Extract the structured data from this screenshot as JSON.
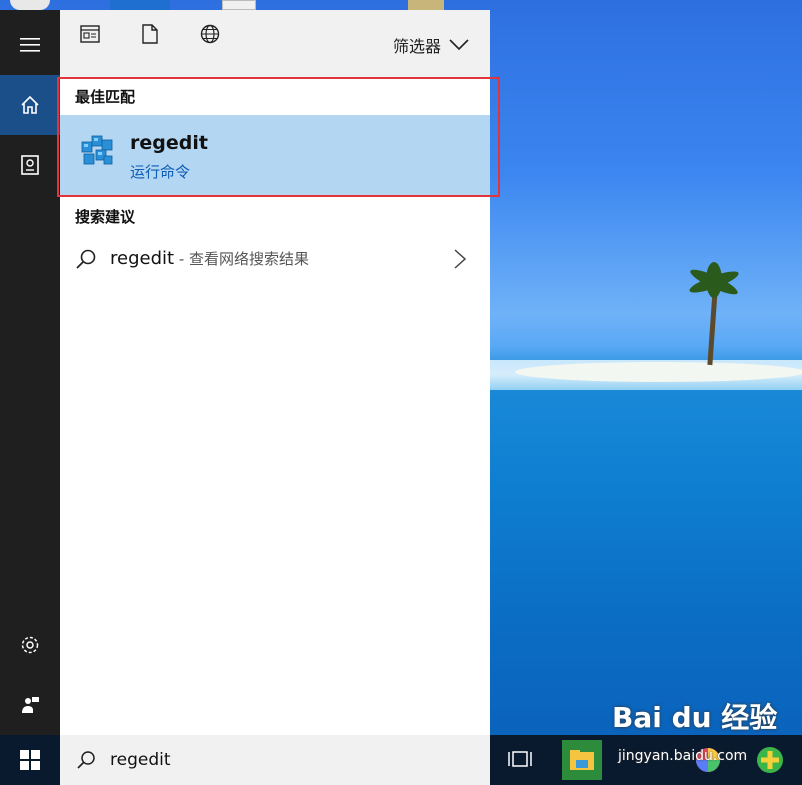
{
  "toolbar": {
    "filter_label": "筛选器"
  },
  "best_match": {
    "section_label": "最佳匹配",
    "title": "regedit",
    "subtitle": "运行命令"
  },
  "suggestions": {
    "section_label": "搜索建议",
    "items": [
      {
        "text": "regedit",
        "suffix": " - 查看网络搜索结果"
      }
    ]
  },
  "search": {
    "value": "regedit"
  },
  "watermark": {
    "logo": "Bai du 经验",
    "url": "jingyan.baidu.com"
  },
  "colors": {
    "selected": "#b3d6f2",
    "highlight_box": "#e0353d",
    "rail": "#1f1f1f",
    "accent": "#1a4f8a"
  }
}
